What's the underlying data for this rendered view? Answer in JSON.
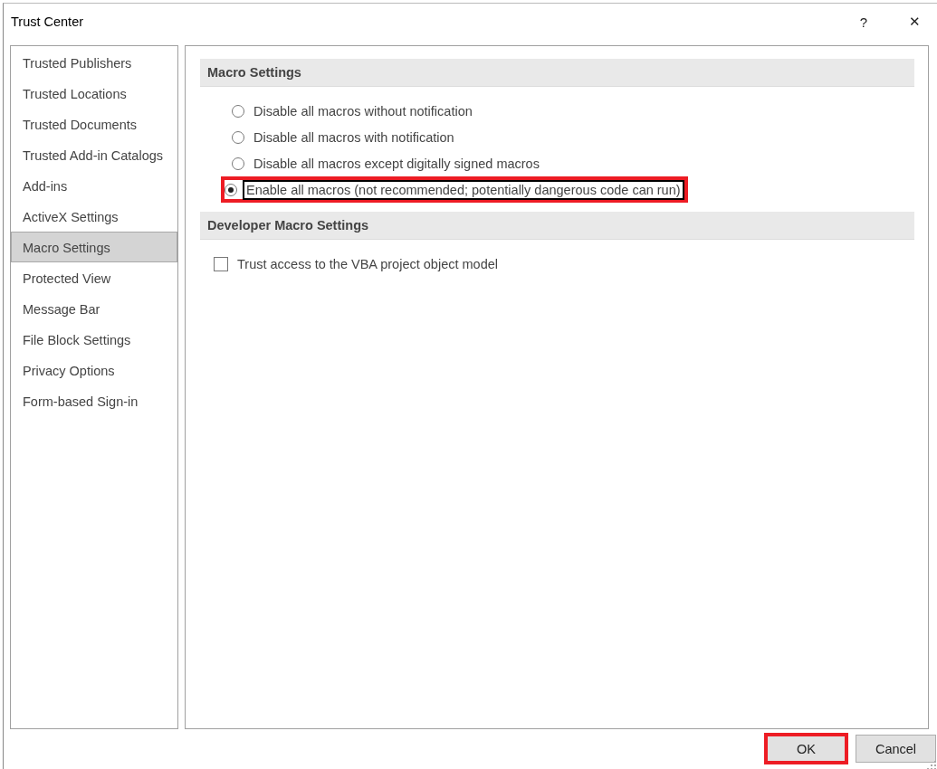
{
  "window": {
    "title": "Trust Center",
    "help": "?",
    "close": "✕"
  },
  "sidebar": {
    "items": [
      {
        "label": "Trusted Publishers",
        "selected": false
      },
      {
        "label": "Trusted Locations",
        "selected": false
      },
      {
        "label": "Trusted Documents",
        "selected": false
      },
      {
        "label": "Trusted Add-in Catalogs",
        "selected": false
      },
      {
        "label": "Add-ins",
        "selected": false
      },
      {
        "label": "ActiveX Settings",
        "selected": false
      },
      {
        "label": "Macro Settings",
        "selected": true
      },
      {
        "label": "Protected View",
        "selected": false
      },
      {
        "label": "Message Bar",
        "selected": false
      },
      {
        "label": "File Block Settings",
        "selected": false
      },
      {
        "label": "Privacy Options",
        "selected": false
      },
      {
        "label": "Form-based Sign-in",
        "selected": false
      }
    ]
  },
  "sections": [
    {
      "heading": "Macro Settings",
      "kind": "radio",
      "options": [
        {
          "label": "Disable all macros without notification",
          "selected": false,
          "highlighted": false
        },
        {
          "label": "Disable all macros with notification",
          "selected": false,
          "highlighted": false
        },
        {
          "label": "Disable all macros except digitally signed macros",
          "selected": false,
          "highlighted": false
        },
        {
          "label": "Enable all macros (not recommended; potentially dangerous code can run)",
          "selected": true,
          "highlighted": true
        }
      ]
    },
    {
      "heading": "Developer Macro Settings",
      "kind": "checkbox",
      "options": [
        {
          "label": "Trust access to the VBA project object model",
          "checked": false,
          "highlighted": false
        }
      ]
    }
  ],
  "buttons": [
    {
      "label": "OK",
      "highlighted": true
    },
    {
      "label": "Cancel",
      "highlighted": false
    }
  ]
}
